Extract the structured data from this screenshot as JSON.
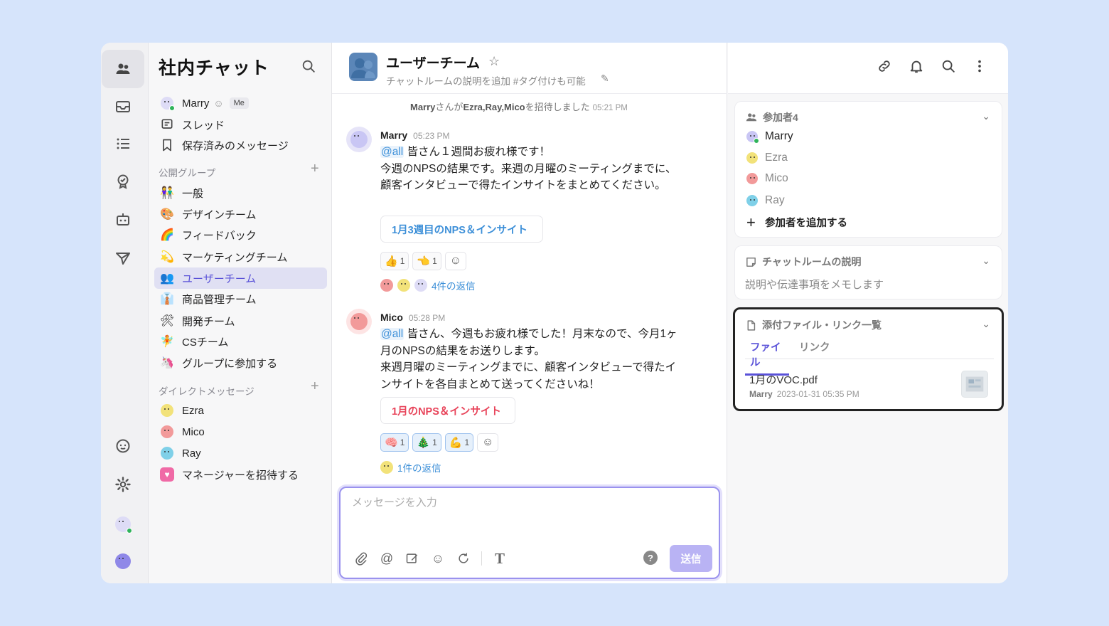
{
  "app": {
    "title": "社内チャット"
  },
  "sidebar": {
    "me": {
      "name": "Marry",
      "badge": "Me"
    },
    "nav": [
      {
        "label": "スレッド",
        "icon": "thread-icon"
      },
      {
        "label": "保存済みのメッセージ",
        "icon": "bookmark-icon"
      }
    ],
    "public_groups_label": "公開グループ",
    "groups": [
      {
        "label": "一般",
        "emoji": "👫"
      },
      {
        "label": "デザインチーム",
        "emoji": "🎨"
      },
      {
        "label": "フィードバック",
        "emoji": "🌈"
      },
      {
        "label": "マーケティングチーム",
        "emoji": "💫"
      },
      {
        "label": "ユーザーチーム",
        "emoji": "👥",
        "active": true
      },
      {
        "label": "商品管理チーム",
        "emoji": "👔"
      },
      {
        "label": "開発チーム",
        "emoji": "🛠"
      },
      {
        "label": "CSチーム",
        "emoji": "🧚"
      },
      {
        "label": "グループに参加する",
        "emoji": "🦄"
      }
    ],
    "dm_label": "ダイレクトメッセージ",
    "dms": [
      {
        "label": "Ezra",
        "color": "#f2e27a"
      },
      {
        "label": "Mico",
        "color": "#f29a9a"
      },
      {
        "label": "Ray",
        "color": "#7fd0e8"
      },
      {
        "label": "マネージャーを招待する",
        "color": "#f06aa6"
      }
    ]
  },
  "chat": {
    "room_name": "ユーザーチーム",
    "room_desc": "チャットルームの説明を追加 #タグ付けも可能",
    "system": {
      "actor": "Marry",
      "text1": "さんが",
      "invited": "Ezra,Ray,Mico",
      "text2": "を招待しました",
      "time": "05:21 PM"
    },
    "messages": [
      {
        "author": "Marry",
        "time": "05:23 PM",
        "mention": "@all",
        "line1": " 皆さん１週間お疲れ様です！",
        "line2": "今週のNPSの結果です。来週の月曜のミーティングまでに、顧客インタビューで得たインサイトをまとめてください。",
        "attachment": "1月3週目のNPS＆インサイト",
        "attachment_color": "#3c8fd8",
        "reactions": [
          {
            "emoji": "👍",
            "count": "1"
          },
          {
            "emoji": "👈",
            "count": "1"
          }
        ],
        "replies": "4件の返信"
      },
      {
        "author": "Mico",
        "time": "05:28 PM",
        "mention": "@all",
        "line1": " 皆さん、今週もお疲れ様でした！月末なので、今月1ヶ月のNPSの結果をお送りします。",
        "line2": "来週月曜のミーティングまでに、顧客インタビューで得たインサイトを各自まとめて送ってくださいね！",
        "attachment": "1月のNPS＆インサイト",
        "attachment_color": "#e8445a",
        "reactions": [
          {
            "emoji": "🧠",
            "count": "1"
          },
          {
            "emoji": "🎄",
            "count": "1"
          },
          {
            "emoji": "💪",
            "count": "1"
          }
        ],
        "replies": "1件の返信"
      }
    ],
    "composer": {
      "placeholder": "メッセージを入力",
      "send": "送信"
    }
  },
  "panel": {
    "participants_title": "参加者4",
    "participants": [
      {
        "name": "Marry",
        "color": "#c9c6f4",
        "muted": false
      },
      {
        "name": "Ezra",
        "color": "#f2e27a",
        "muted": true
      },
      {
        "name": "Mico",
        "color": "#f29a9a",
        "muted": true
      },
      {
        "name": "Ray",
        "color": "#7fd0e8",
        "muted": true
      }
    ],
    "add_participant": "参加者を追加する",
    "desc_title": "チャットルームの説明",
    "desc_placeholder": "説明や伝達事項をメモします",
    "files_title": "添付ファイル・リンク一覧",
    "tab_files": "ファイル",
    "tab_links": "リンク",
    "file": {
      "name": "1月のVOC.pdf",
      "owner": "Marry",
      "date": "2023-01-31 05:35 PM"
    }
  }
}
